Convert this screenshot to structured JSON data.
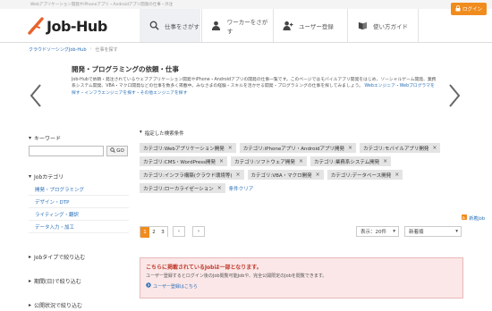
{
  "topbar": {
    "tagline": "Webアプリケーション開発やiPhoneアプリ・Androidアプリ開発の仕事・外注"
  },
  "header": {
    "logo_text": "Job-Hub",
    "login_label": "ログイン",
    "nav": [
      {
        "label": "仕事をさがす",
        "icon": "search-icon"
      },
      {
        "label": "ワーカーをさがす",
        "icon": "person-icon"
      },
      {
        "label": "ユーザー登録",
        "icon": "user-plus-icon"
      },
      {
        "label": "使い方ガイド",
        "icon": "book-icon"
      }
    ]
  },
  "breadcrumb": [
    "クラウドソーシングJob-Hub",
    "仕事を探す"
  ],
  "feature": {
    "title": "開発・プログラミングの依頼・仕事",
    "desc": "Job-Hubで依頼・発注されているウェブアプリケーション開発やiPhone・Androidアプリの開発の仕事一覧です。このページではモバイルアプリ開発をはじめ、ソーシャルゲーム開発、業務系システム開発、VBA・マクロ開発などの仕事を数多く掲載中。みなさまの経験・スキルを活かせる開発・プログラミングの仕事を探してみましょう。",
    "link": "Webエンジニア・Webプログラマを探す・インフラエンジニアを探す・その他エンジニアを探す"
  },
  "sidebar": {
    "keyword_title": "キーワード",
    "go_label": "GO",
    "category_title": "Jobカテゴリ",
    "categories": [
      "開発・プログラミング",
      "デザイン・DTP",
      "ライティング・翻訳",
      "データ入力・加工"
    ],
    "type_title": "Jobタイプで絞り込む",
    "period_title": "期間(日)で絞り込む",
    "posted_title": "公開状況で絞り込む"
  },
  "main": {
    "conditions_title": "指定した検索条件",
    "chips": [
      "カテゴリ:Webアプリケーション開発",
      "カテゴリ:iPhoneアプリ・Androidアプリ開発",
      "カテゴリ:モバイルアプリ開発",
      "カテゴリ:CMS・WordPress開発",
      "カテゴリ:ソフトウェア開発",
      "カテゴリ:業務系システム開発",
      "カテゴリ:インフラ構築(クラウド環境等)",
      "カテゴリ:VBA・マクロ開発",
      "カテゴリ:データベース開発",
      "カテゴリ:ローカライゼーション"
    ],
    "clear_label": "条件クリア",
    "watch_label": "新着Job",
    "pages": [
      "1",
      "2",
      "3"
    ],
    "prev_label": "‹",
    "next_label": "›",
    "per_page": "表示：20件",
    "sort": "新着順",
    "notice_title": "こちらに掲載されているJobは一部となります。",
    "notice_body": "ユーザー登録するとログイン後のJob閲覧可能Jobや、完全公開限定のJobを閲覧できます。",
    "notice_link": "ユーザー登録はこちら"
  },
  "colors": {
    "accent": "#f08c1e",
    "link": "#2a6fb8",
    "notice_bg": "#fbe7e7"
  }
}
